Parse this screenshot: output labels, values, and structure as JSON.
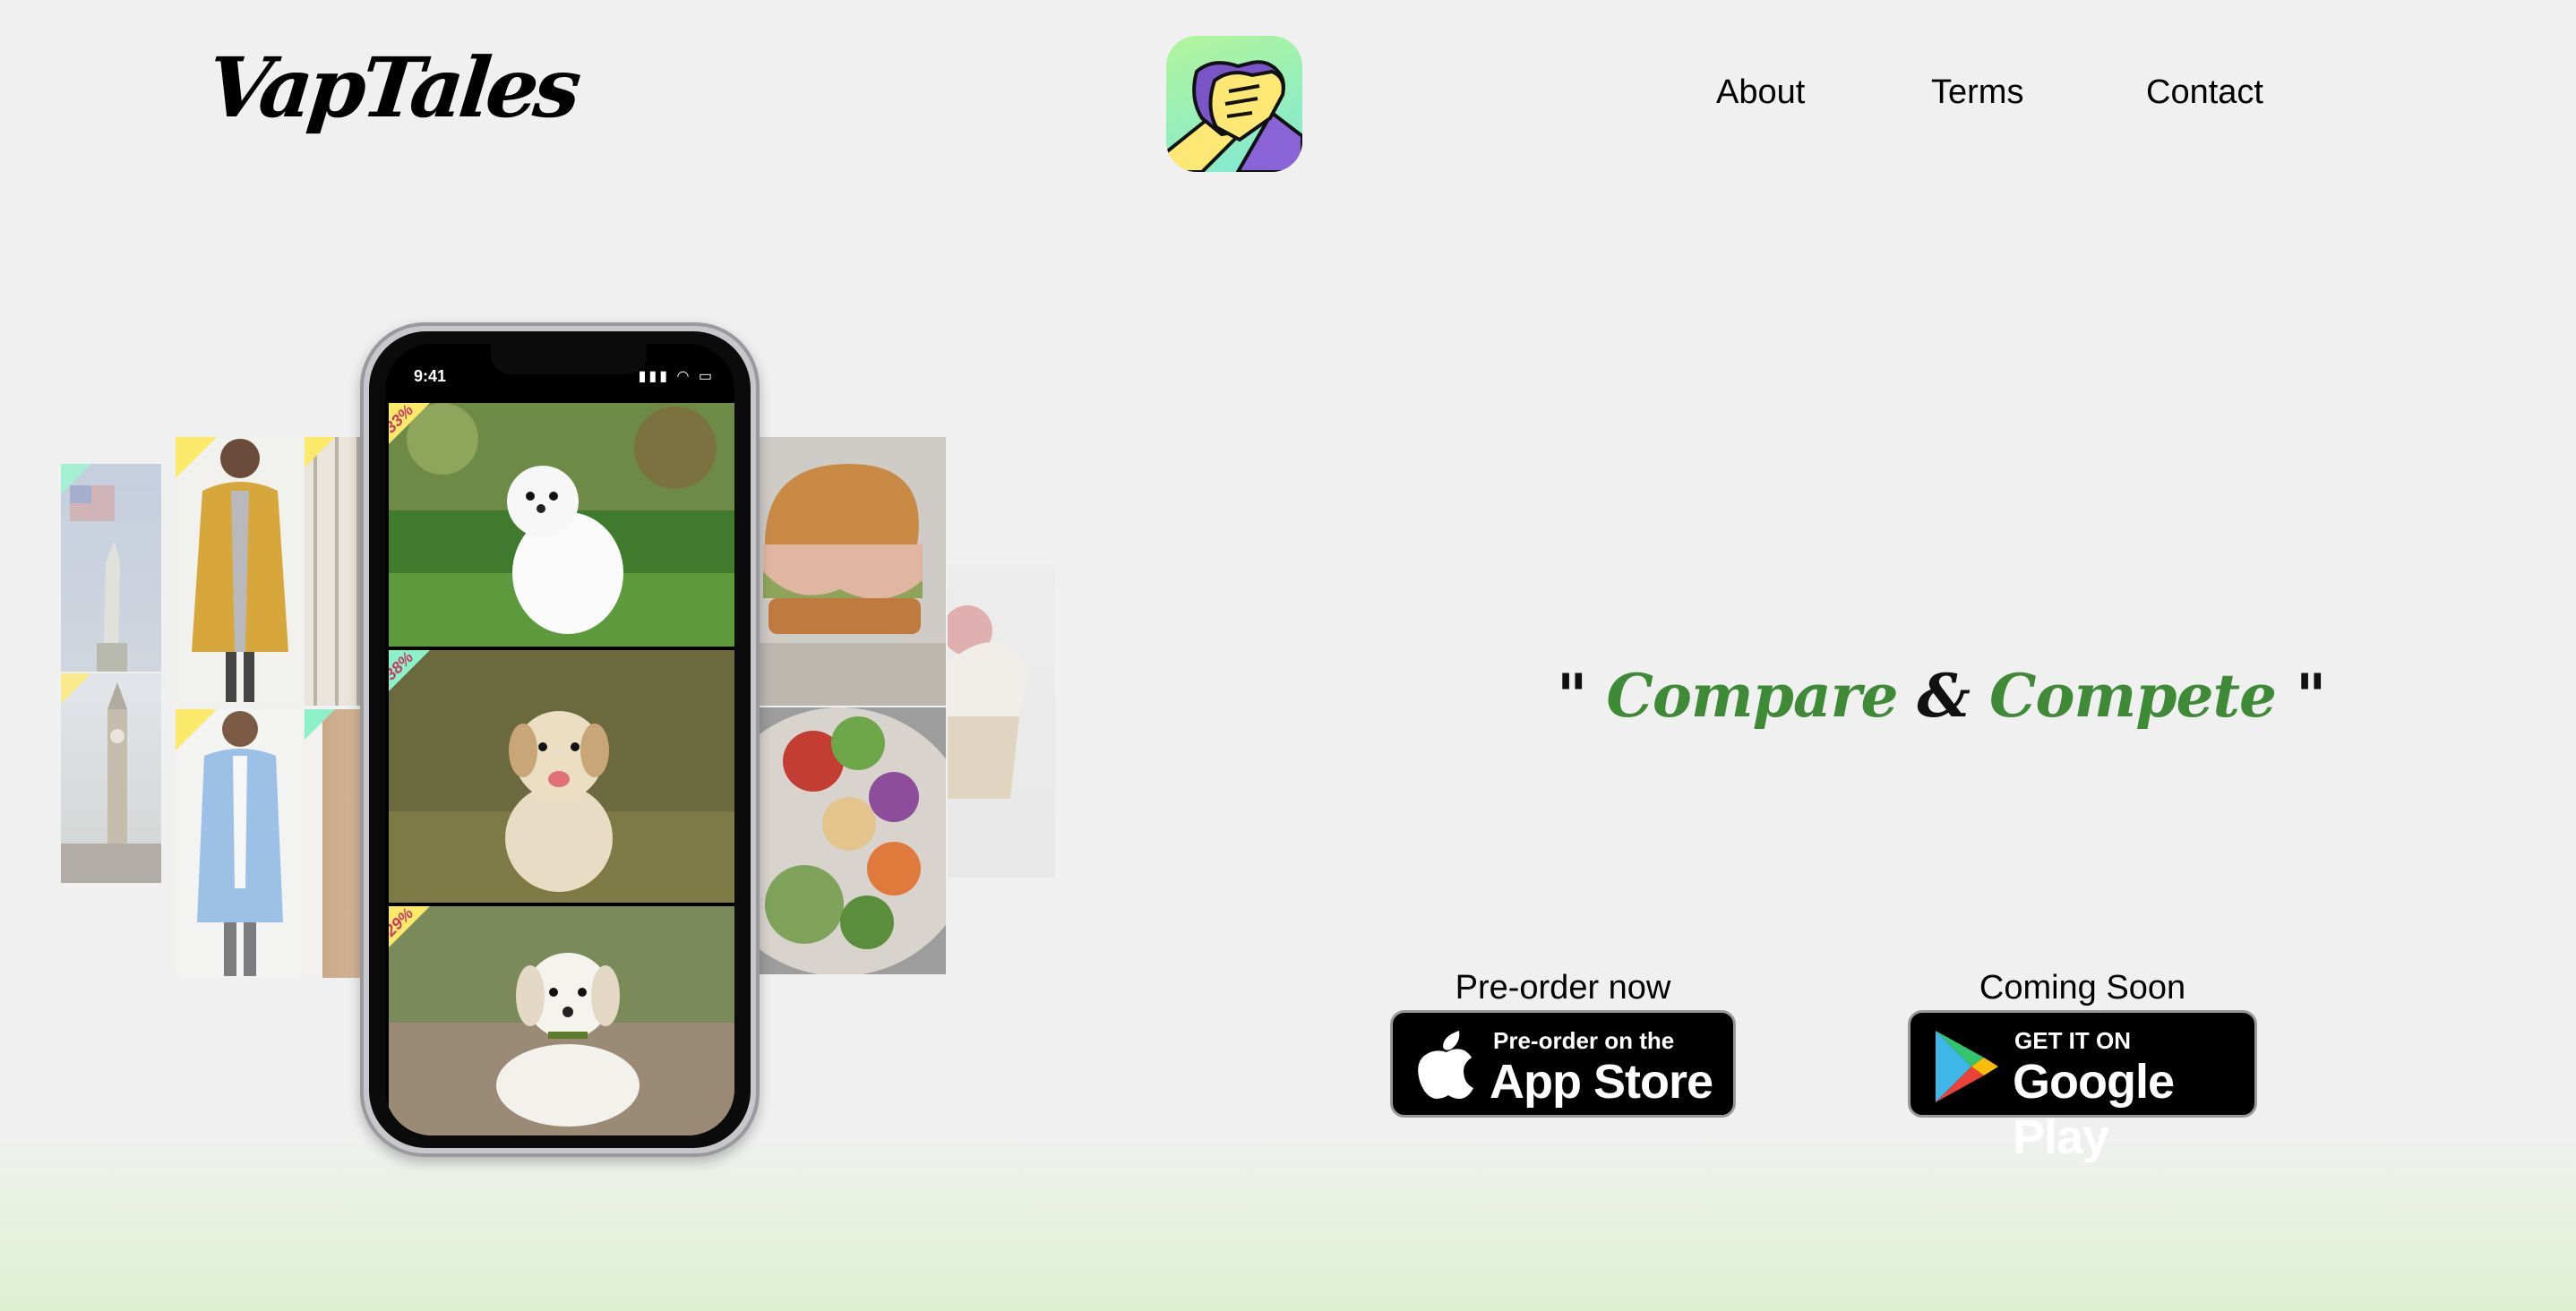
{
  "header": {
    "logo_text": "VapTales",
    "nav": {
      "about": "About",
      "terms": "Terms",
      "contact": "Contact"
    }
  },
  "phone": {
    "status_time": "9:41",
    "status_icons": "▮▮▮ ◠ ▭",
    "screens": [
      {
        "badge": "33%"
      },
      {
        "badge": "38%"
      },
      {
        "badge": "29%"
      }
    ]
  },
  "hero": {
    "quote_open": "\"",
    "word1": "Compare",
    "amp": "&",
    "word2": "Compete",
    "quote_close": "\""
  },
  "stores": {
    "apple": {
      "label": "Pre-order now",
      "small": "Pre-order on the",
      "big": "App Store"
    },
    "google": {
      "label": "Coming Soon",
      "small": "GET IT ON",
      "big": "Google Play"
    }
  },
  "colors": {
    "accent_green": "#3e8a36",
    "background": "#f0f0f0",
    "footer_gradient": "#ddf0cf"
  }
}
